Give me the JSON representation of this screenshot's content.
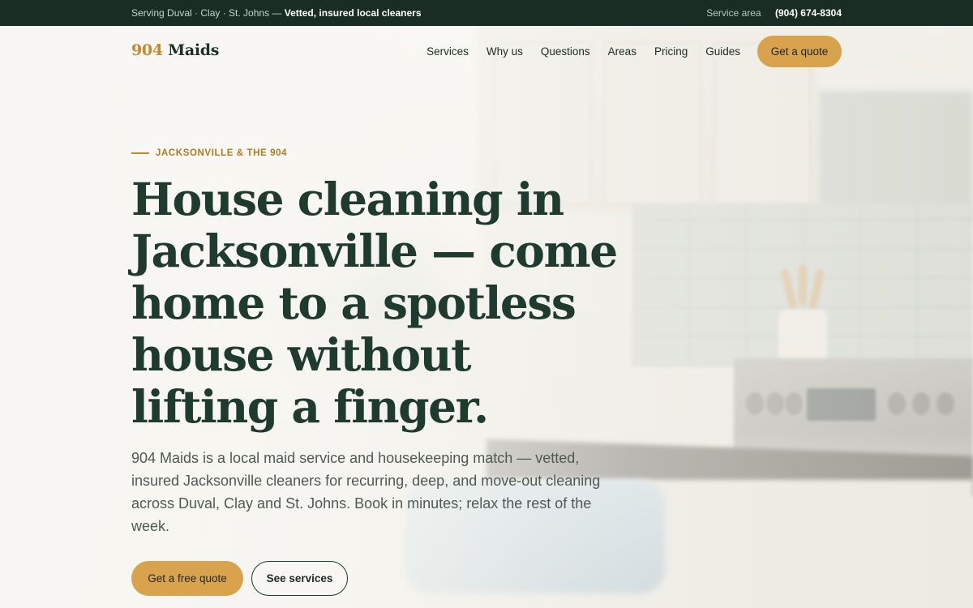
{
  "topbar": {
    "serving_text": "Serving Duval · Clay · St. Johns —",
    "serving_strong": "Vetted, insured local cleaners",
    "service_area_label": "Service area",
    "phone": "(904) 674-8304"
  },
  "header": {
    "logo_number": "904",
    "logo_word": "Maids",
    "nav": [
      "Services",
      "Why us",
      "Questions",
      "Areas",
      "Pricing",
      "Guides"
    ],
    "quote_button": "Get a quote"
  },
  "hero": {
    "eyebrow": "JACKSONVILLE & THE 904",
    "headline": "House cleaning in Jacksonville — come home to a spotless house without lifting a finger.",
    "lede": "904 Maids is a local maid service and housekeeping match — vetted, insured Jacksonville cleaners for recurring, deep, and move-out cleaning across Duval, Clay and St. Johns. Book in minutes; relax the rest of the week.",
    "primary_cta": "Get a free quote",
    "secondary_cta": "See services"
  },
  "colors": {
    "topbar_bg": "#1a2d25",
    "brand_green": "#1f3a2f",
    "accent_gold": "#d9a24c",
    "eyebrow_gold": "#b07a22"
  }
}
